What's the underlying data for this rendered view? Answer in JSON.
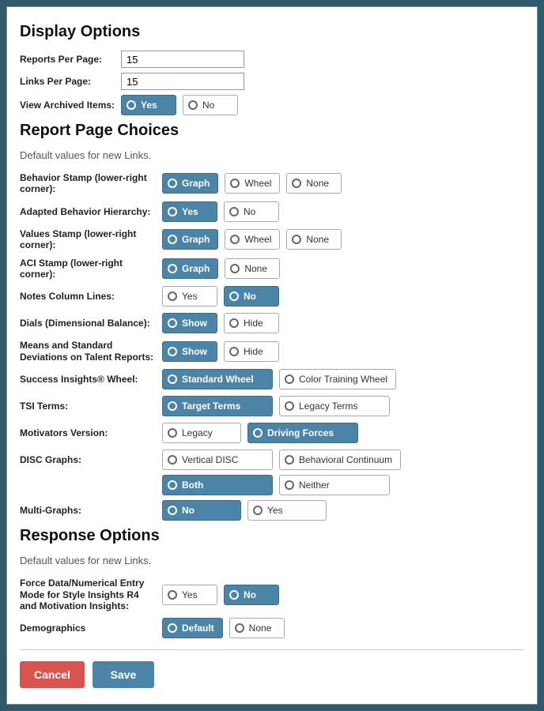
{
  "display": {
    "heading": "Display Options",
    "reportsPerPageLabel": "Reports Per Page:",
    "reportsPerPageValue": "15",
    "linksPerPageLabel": "Links Per Page:",
    "linksPerPageValue": "15",
    "viewArchivedLabel": "View Archived Items:",
    "viewArchived": {
      "yes": "Yes",
      "no": "No",
      "selected": "yes"
    }
  },
  "report": {
    "heading": "Report Page Choices",
    "subtext": "Default values for new Links.",
    "behaviorStampLabel": "Behavior Stamp (lower-right corner):",
    "behaviorStamp": {
      "graph": "Graph",
      "wheel": "Wheel",
      "none": "None",
      "selected": "graph"
    },
    "adaptedHierarchyLabel": "Adapted Behavior Hierarchy:",
    "adaptedHierarchy": {
      "yes": "Yes",
      "no": "No",
      "selected": "yes"
    },
    "valuesStampLabel": "Values Stamp (lower-right corner):",
    "valuesStamp": {
      "graph": "Graph",
      "wheel": "Wheel",
      "none": "None",
      "selected": "graph"
    },
    "aciStampLabel": "ACI Stamp (lower-right corner):",
    "aciStamp": {
      "graph": "Graph",
      "none": "None",
      "selected": "graph"
    },
    "notesLabel": "Notes Column Lines:",
    "notes": {
      "yes": "Yes",
      "no": "No",
      "selected": "no"
    },
    "dialsLabel": "Dials (Dimensional Balance):",
    "dials": {
      "show": "Show",
      "hide": "Hide",
      "selected": "show"
    },
    "meansLabel": "Means and Standard Deviations on Talent Reports:",
    "means": {
      "show": "Show",
      "hide": "Hide",
      "selected": "show"
    },
    "successWheelLabel": "Success Insights® Wheel:",
    "successWheel": {
      "standard": "Standard Wheel",
      "color": "Color Training Wheel",
      "selected": "standard"
    },
    "tsiLabel": "TSI Terms:",
    "tsi": {
      "target": "Target Terms",
      "legacy": "Legacy Terms",
      "selected": "target"
    },
    "motivatorsLabel": "Motivators Version:",
    "motivators": {
      "legacy": "Legacy",
      "driving": "Driving Forces",
      "selected": "driving"
    },
    "discLabel": "DISC Graphs:",
    "disc": {
      "vertical": "Vertical DISC",
      "behavioral": "Behavioral Continuum",
      "both": "Both",
      "neither": "Neither",
      "selected": "both"
    },
    "multiLabel": "Multi-Graphs:",
    "multi": {
      "no": "No",
      "yes": "Yes",
      "selected": "no"
    }
  },
  "response": {
    "heading": "Response Options",
    "subtext": "Default values for new Links.",
    "forceDataLabel": "Force Data/Numerical Entry Mode for Style Insights R4 and Motivation Insights:",
    "forceData": {
      "yes": "Yes",
      "no": "No",
      "selected": "no"
    },
    "demographicsLabel": "Demographics",
    "demographics": {
      "default": "Default",
      "none": "None",
      "selected": "default"
    }
  },
  "footer": {
    "cancel": "Cancel",
    "save": "Save"
  }
}
